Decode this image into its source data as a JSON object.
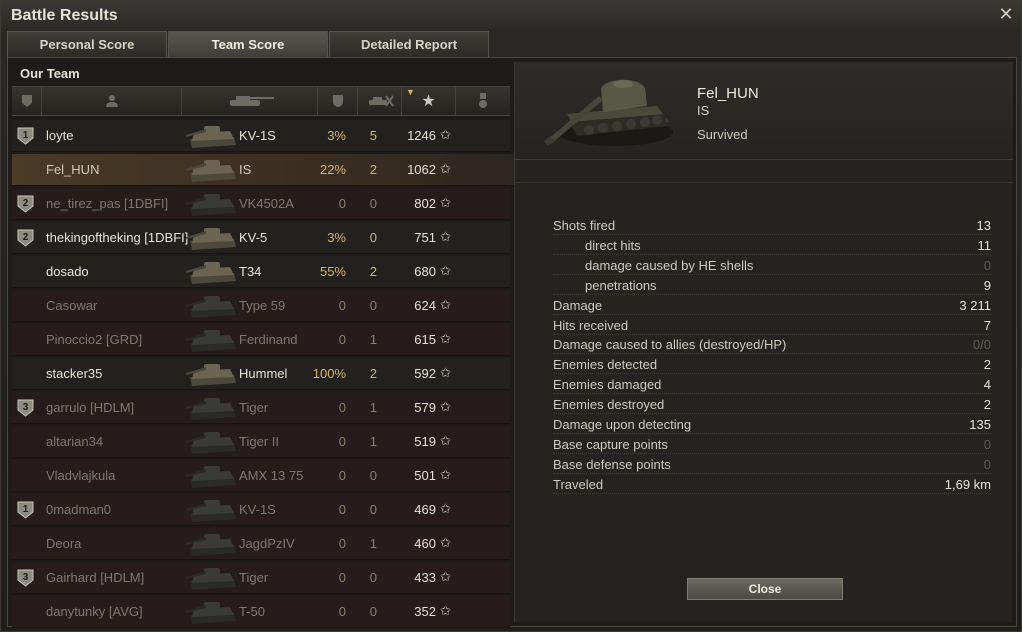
{
  "window": {
    "title": "Battle Results"
  },
  "tabs": [
    {
      "label": "Personal Score"
    },
    {
      "label": "Team Score"
    },
    {
      "label": "Detailed Report"
    }
  ],
  "team": {
    "label": "Our Team",
    "columns": [
      "vehicle-class-icon",
      "player-icon",
      "tank-icon",
      "damage-icon",
      "kills-icon",
      "xp-star-icon",
      "medal-icon"
    ],
    "rows": [
      {
        "medal": "1",
        "name": "loyte",
        "tank": "KV-1S",
        "damage": "3%",
        "kills": "5",
        "xp": "1246",
        "state": "alive"
      },
      {
        "medal": "",
        "name": "Fel_HUN",
        "tank": "IS",
        "damage": "22%",
        "kills": "2",
        "xp": "1062",
        "state": "selected"
      },
      {
        "medal": "2",
        "name": "ne_tirez_pas [1DBFI]",
        "tank": "VK4502A",
        "damage": "0",
        "kills": "0",
        "xp": "802",
        "state": "dead"
      },
      {
        "medal": "2",
        "name": "thekingoftheking [1DBFI]",
        "tank": "KV-5",
        "damage": "3%",
        "kills": "0",
        "xp": "751",
        "state": "alive"
      },
      {
        "medal": "",
        "name": "dosado",
        "tank": "T34",
        "damage": "55%",
        "kills": "2",
        "xp": "680",
        "state": "alive"
      },
      {
        "medal": "",
        "name": "Casowar",
        "tank": "Type 59",
        "damage": "0",
        "kills": "0",
        "xp": "624",
        "state": "dead"
      },
      {
        "medal": "",
        "name": "Pinoccio2 [GRD]",
        "tank": "Ferdinand",
        "damage": "0",
        "kills": "1",
        "xp": "615",
        "state": "dead"
      },
      {
        "medal": "",
        "name": "stacker35",
        "tank": "Hummel",
        "damage": "100%",
        "kills": "2",
        "xp": "592",
        "state": "alive"
      },
      {
        "medal": "3",
        "name": "garrulo [HDLM]",
        "tank": "Tiger",
        "damage": "0",
        "kills": "1",
        "xp": "579",
        "state": "dead"
      },
      {
        "medal": "",
        "name": "altarian34",
        "tank": "Tiger II",
        "damage": "0",
        "kills": "1",
        "xp": "519",
        "state": "dead"
      },
      {
        "medal": "",
        "name": "Vladvlajkula",
        "tank": "AMX 13 75",
        "damage": "0",
        "kills": "0",
        "xp": "501",
        "state": "dead"
      },
      {
        "medal": "1",
        "name": "0madman0",
        "tank": "KV-1S",
        "damage": "0",
        "kills": "0",
        "xp": "469",
        "state": "dead"
      },
      {
        "medal": "",
        "name": "Deora",
        "tank": "JagdPzIV",
        "damage": "0",
        "kills": "1",
        "xp": "460",
        "state": "dead"
      },
      {
        "medal": "3",
        "name": "Gairhard [HDLM]",
        "tank": "Tiger",
        "damage": "0",
        "kills": "0",
        "xp": "433",
        "state": "dead"
      },
      {
        "medal": "",
        "name": "danytunky [AVG]",
        "tank": "T-50",
        "damage": "0",
        "kills": "0",
        "xp": "352",
        "state": "dead"
      }
    ]
  },
  "detail": {
    "player_name": "Fel_HUN",
    "tank": "IS",
    "status": "Survived",
    "stats": [
      {
        "label": "Shots fired",
        "value": "13",
        "sub": false,
        "zero": false
      },
      {
        "label": "direct hits",
        "value": "11",
        "sub": true,
        "zero": false
      },
      {
        "label": "damage caused by HE shells",
        "value": "0",
        "sub": true,
        "zero": true
      },
      {
        "label": "penetrations",
        "value": "9",
        "sub": true,
        "zero": false
      },
      {
        "label": "Damage",
        "value": "3 211",
        "sub": false,
        "zero": false
      },
      {
        "label": "Hits received",
        "value": "7",
        "sub": false,
        "zero": false
      },
      {
        "label": "Damage caused to allies (destroyed/HP)",
        "value": "0/0",
        "sub": false,
        "zero": true
      },
      {
        "label": "Enemies detected",
        "value": "2",
        "sub": false,
        "zero": false
      },
      {
        "label": "Enemies damaged",
        "value": "4",
        "sub": false,
        "zero": false
      },
      {
        "label": "Enemies destroyed",
        "value": "2",
        "sub": false,
        "zero": false
      },
      {
        "label": "Damage upon detecting",
        "value": "135",
        "sub": false,
        "zero": false
      },
      {
        "label": "Base capture points",
        "value": "0",
        "sub": false,
        "zero": true
      },
      {
        "label": "Base defense points",
        "value": "0",
        "sub": false,
        "zero": true
      },
      {
        "label": "Traveled",
        "value": "1,69 km",
        "sub": false,
        "zero": false
      }
    ],
    "close_label": "Close"
  },
  "colors": {
    "accent": "#d9b45c",
    "dead_row": "#251c1b",
    "selected_row": "#4a3a26"
  }
}
